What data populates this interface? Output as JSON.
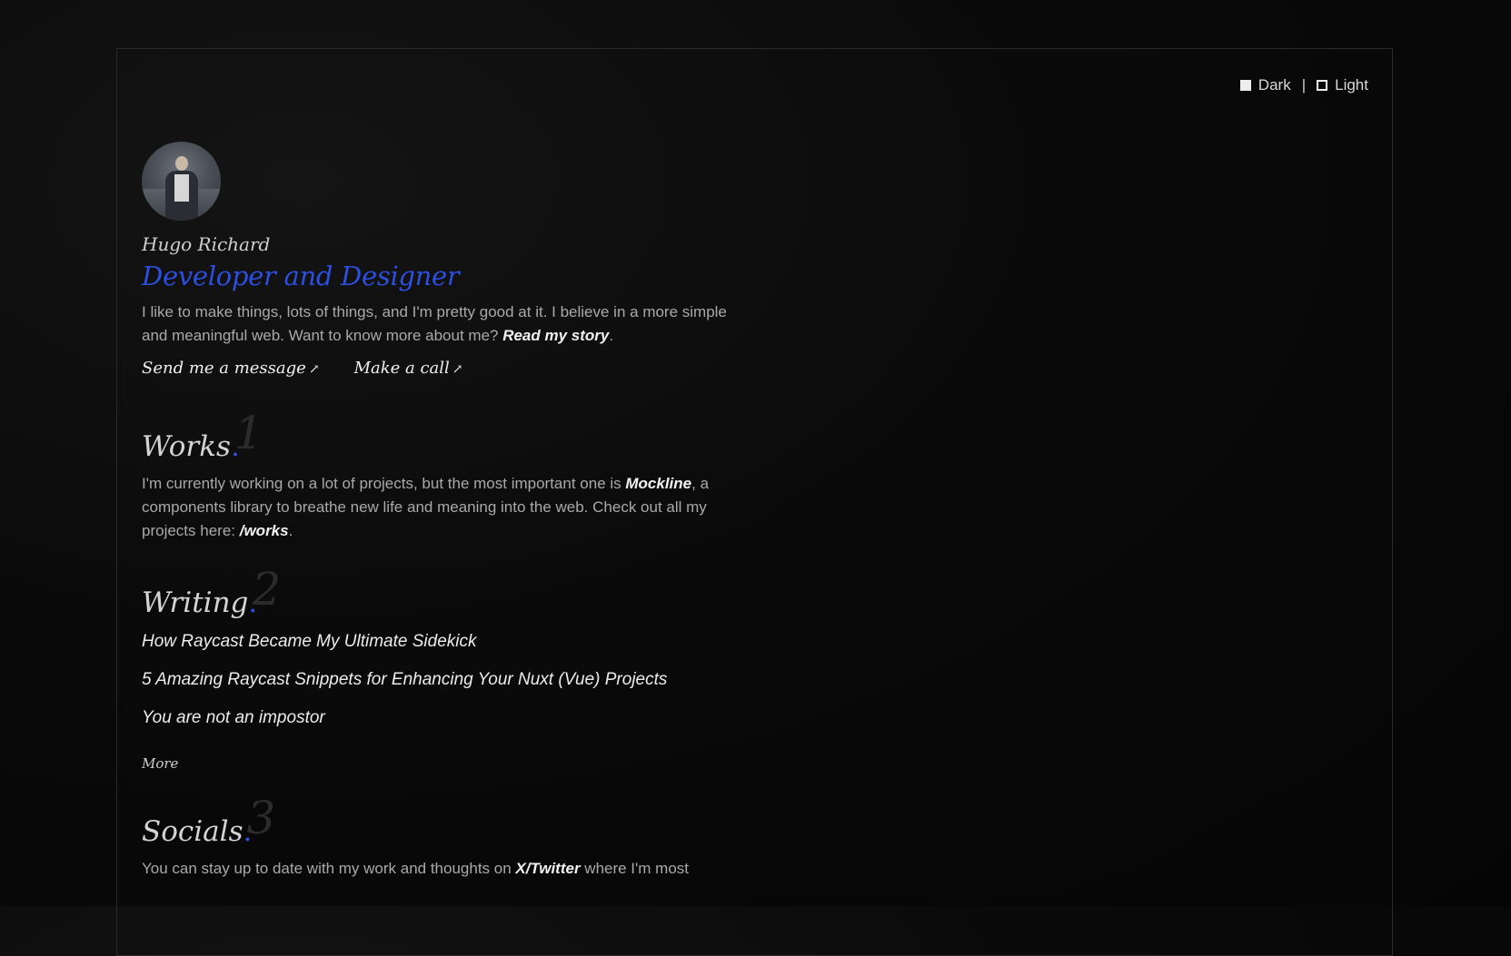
{
  "theme": {
    "dark_label": "Dark",
    "separator": "|",
    "light_label": "Light"
  },
  "profile": {
    "name": "Hugo Richard",
    "role": "Developer and Designer",
    "intro_text": "I like to make things, lots of things, and I'm pretty good at it. I believe in a more simple and meaningful web. Want to know more about me? ",
    "intro_link": "Read my story",
    "intro_end": ".",
    "cta_message": "Send me a message",
    "cta_call": "Make a call",
    "arrow": "↗"
  },
  "works": {
    "title": "Works",
    "dot": ".",
    "number": "1",
    "text_start": "I'm currently working on a lot of projects, but the most important one is ",
    "link_mockline": "Mockline",
    "text_mid": ", a components library to breathe new life and meaning into the web. Check out all my projects here: ",
    "link_works": "/works",
    "text_end": "."
  },
  "writing": {
    "title": "Writing",
    "dot": ".",
    "number": "2",
    "posts": [
      "How Raycast Became My Ultimate Sidekick",
      "5 Amazing Raycast Snippets for Enhancing Your Nuxt (Vue) Projects",
      "You are not an impostor"
    ],
    "more": "More"
  },
  "socials": {
    "title": "Socials",
    "dot": ".",
    "number": "3",
    "text_start": "You can stay up to date with my work and thoughts on ",
    "link_twitter": "X/Twitter",
    "text_end": " where I'm most"
  },
  "colors": {
    "accent": "#2d4fe0",
    "background": "#070707",
    "border": "#2a2a2a"
  }
}
